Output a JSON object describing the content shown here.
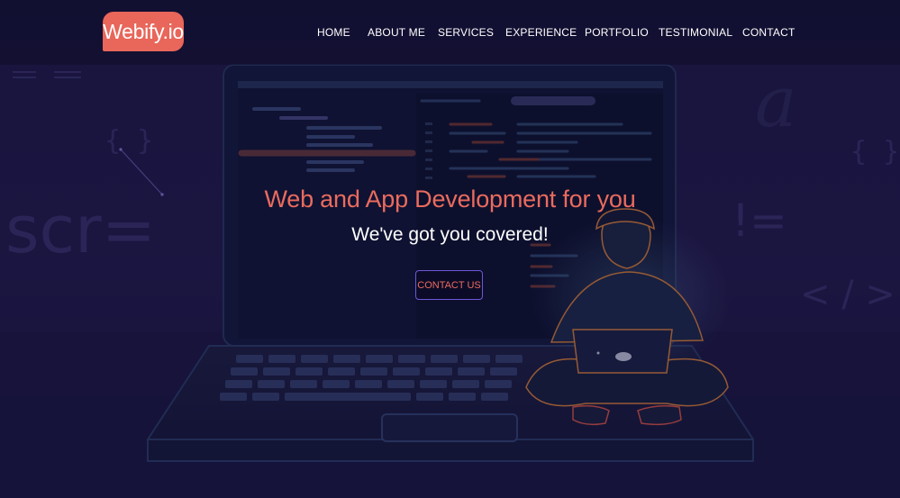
{
  "header": {
    "logo_text": "Webify.io",
    "nav": [
      "HOME",
      "ABOUT ME",
      "SERVICES",
      "EXPERIENCE",
      "PORTFOLIO",
      "TESTIMONIAL",
      "CONTACT"
    ]
  },
  "hero": {
    "title": "Web and App Development for you",
    "subtitle": "We've got you covered!",
    "cta_label": "CONTACT US"
  },
  "background": {
    "decor_text_left": "scr=",
    "decor_text_right": "!=",
    "decor_braces": "{ }",
    "decor_tag": "< / >",
    "decor_letter": "a"
  },
  "colors": {
    "accent": "#ea6b5e",
    "logo_bg": "#e8665a",
    "cta_border": "#6d57d8",
    "background": "#1e1a48"
  }
}
